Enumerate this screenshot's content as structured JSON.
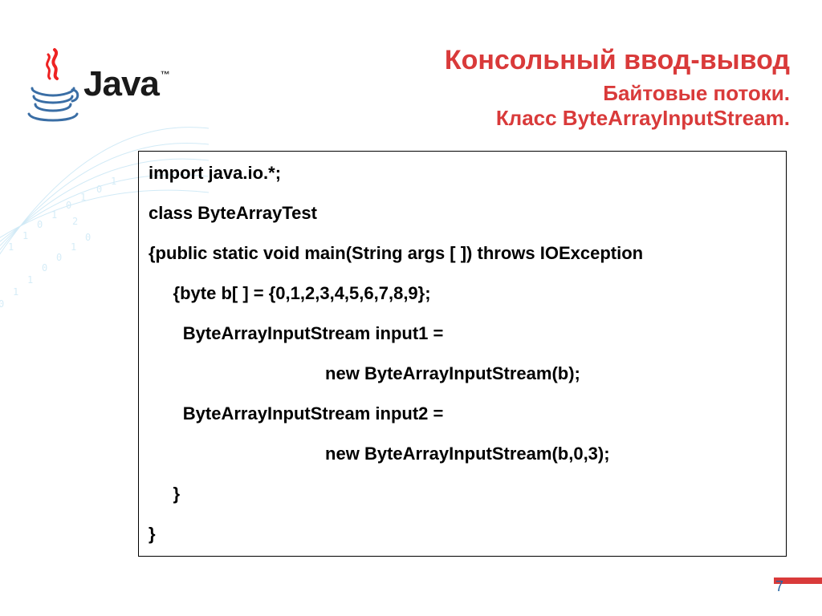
{
  "logo": {
    "text": "Java",
    "tm": "™"
  },
  "title": {
    "main": "Консольный ввод-вывод",
    "sub1": "Байтовые потоки.",
    "sub2": "Класс ByteArrayInputStream."
  },
  "code": {
    "l1": "import java.io.*;",
    "l2": "class ByteArrayTest",
    "l3": "{public static void main(String args [ ]) throws IOException",
    "l4": "     {byte b[ ] = {0,1,2,3,4,5,6,7,8,9};",
    "l5": "       ByteArrayInputStream input1 =",
    "l6": "                                    new ByteArrayInputStream(b);",
    "l7": "       ByteArrayInputStream input2 =",
    "l8": "                                    new ByteArrayInputStream(b,0,3);",
    "l9": "     }",
    "l10": "}"
  },
  "page_number": "7"
}
